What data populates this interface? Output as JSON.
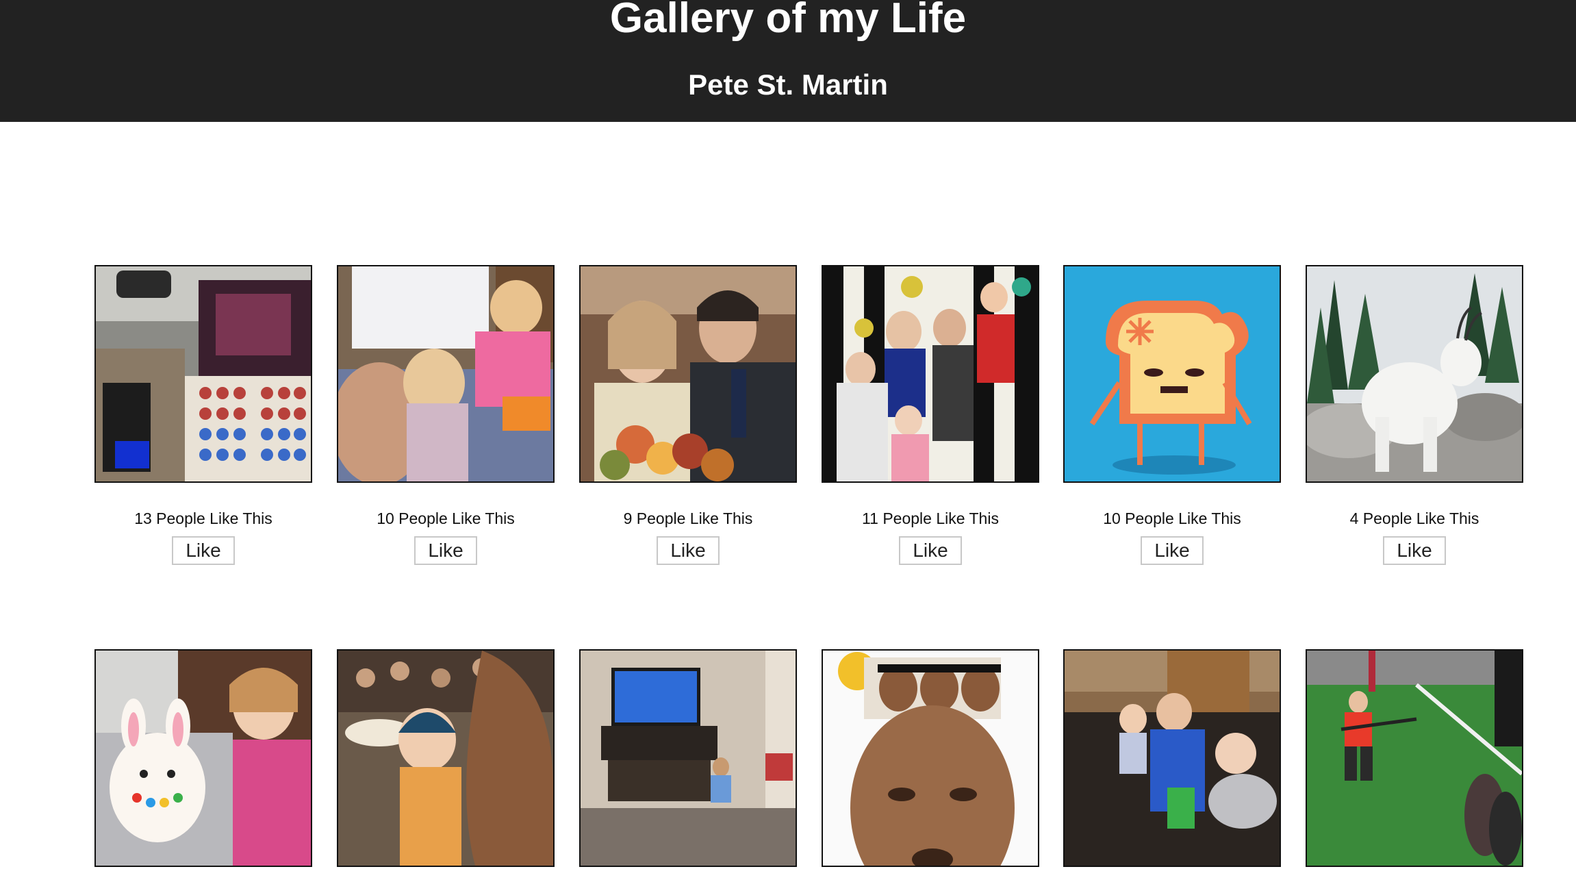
{
  "header": {
    "title": "Gallery of my Life",
    "author": "Pete St. Martin"
  },
  "gallery": {
    "like_label": "Like",
    "items": [
      {
        "likes_text": "13 People Like This"
      },
      {
        "likes_text": "10 People Like This"
      },
      {
        "likes_text": "9 People Like This"
      },
      {
        "likes_text": "11 People Like This"
      },
      {
        "likes_text": "10 People Like This"
      },
      {
        "likes_text": "4 People Like This"
      },
      {
        "likes_text": ""
      },
      {
        "likes_text": ""
      },
      {
        "likes_text": ""
      },
      {
        "likes_text": ""
      },
      {
        "likes_text": ""
      },
      {
        "likes_text": ""
      }
    ]
  },
  "colors": {
    "header_bg": "#222222",
    "header_text": "#ffffff",
    "frame_border": "#111111",
    "button_border": "#c8c8c8"
  }
}
